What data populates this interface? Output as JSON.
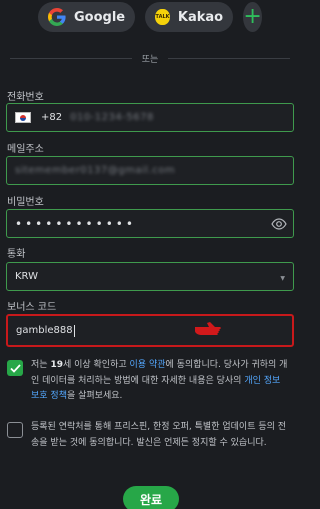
{
  "social": {
    "google_label": "Google",
    "kakao_label": "Kakao",
    "kakao_badge": "TALK",
    "more_label": "+"
  },
  "divider_text": "또는",
  "phone": {
    "label": "전화번호",
    "country_code": "+82",
    "number": "010-1234-5678"
  },
  "email": {
    "label": "메일주소",
    "value": "sitemember0137@gmail.com"
  },
  "password": {
    "label": "비밀번호",
    "value": "••••••••••••"
  },
  "currency": {
    "label": "통화",
    "value": "KRW"
  },
  "bonus_code": {
    "label": "보너스 코드",
    "value": "gamble888"
  },
  "agreements": {
    "age_terms": {
      "checked": true,
      "text_1": "저는",
      "age": "19",
      "text_2": "세 이상 확인하고",
      "terms_link": "이용 약관",
      "text_3": "에 동의합니다. 당사가 귀하의 개인 데이터를 처리하는 방법에 대한 자세한 내용은 당사의",
      "privacy_link": "개인 정보 보호 정책",
      "text_4": "을 살펴보세요."
    },
    "marketing": {
      "checked": false,
      "text": "등록된 연락처를 통해 프리스핀, 한정 오퍼, 특별한 업데이트 등의 전송을 받는 것에 동의합니다. 발신은 언제든 정지할 수 있습니다."
    }
  },
  "submit_label": "완료",
  "colors": {
    "accent_green": "#27a748",
    "highlight_red": "#c8191b",
    "link_blue": "#54a8ff",
    "background": "#1b1d21"
  }
}
